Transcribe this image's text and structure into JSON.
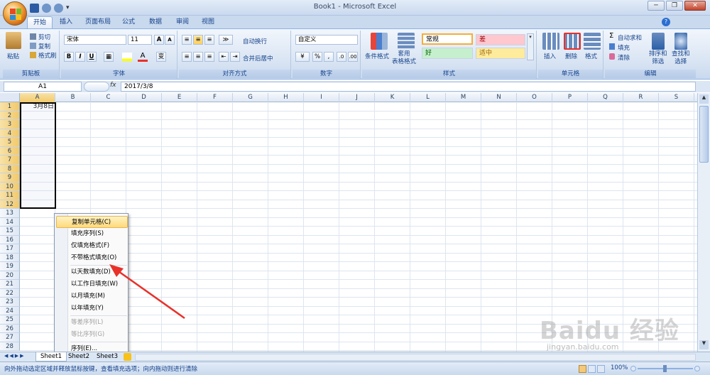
{
  "window": {
    "title": "Book1 - Microsoft Excel",
    "minimize": "─",
    "restore": "❐",
    "close": "✕"
  },
  "tabs": [
    "开始",
    "插入",
    "页面布局",
    "公式",
    "数据",
    "审阅",
    "视图"
  ],
  "ribbon": {
    "clipboard": {
      "label": "剪贴板",
      "paste": "粘贴",
      "cut": "剪切",
      "copy": "复制",
      "format_painter": "格式刷"
    },
    "font": {
      "label": "字体",
      "font_name": "宋体",
      "font_size": "11",
      "bold": "B",
      "italic": "I",
      "underline": "U",
      "grow": "A",
      "shrink": "A",
      "phonetic": "变"
    },
    "alignment": {
      "label": "对齐方式",
      "wrap": "自动换行",
      "merge": "合并后居中"
    },
    "number": {
      "label": "数字",
      "format": "自定义",
      "percent": "%",
      "comma": ","
    },
    "styles": {
      "label": "样式",
      "cond_format": "条件格式",
      "table_format": "套用\n表格格式",
      "normal": "常规",
      "bad": "差",
      "good": "好",
      "neutral": "适中"
    },
    "cells": {
      "label": "单元格",
      "insert": "插入",
      "delete": "删除",
      "format": "格式"
    },
    "editing": {
      "label": "编辑",
      "autosum": "自动求和",
      "fill": "填充",
      "clear": "清除",
      "sort": "排序和\n筛选",
      "find": "查找和\n选择"
    }
  },
  "formula_bar": {
    "name_box": "A1",
    "fx": "fx",
    "value": "2017/3/8"
  },
  "columns": [
    "A",
    "B",
    "C",
    "D",
    "E",
    "F",
    "G",
    "H",
    "I",
    "J",
    "K",
    "L",
    "M",
    "N",
    "O",
    "P",
    "Q",
    "R",
    "S"
  ],
  "rows": [
    "1",
    "2",
    "3",
    "4",
    "5",
    "6",
    "7",
    "8",
    "9",
    "10",
    "11",
    "12",
    "13",
    "14",
    "15",
    "16",
    "17",
    "18",
    "19",
    "20",
    "21",
    "22",
    "23",
    "24",
    "25",
    "26",
    "27",
    "28"
  ],
  "cells": {
    "A1": "3月8日"
  },
  "context_menu": {
    "items": [
      {
        "label": "复制单元格(C)",
        "state": "highlighted"
      },
      {
        "label": "填充序列(S)",
        "state": "normal"
      },
      {
        "label": "仅填充格式(F)",
        "state": "normal"
      },
      {
        "label": "不带格式填充(O)",
        "state": "normal"
      },
      {
        "label": "以天数填充(D)",
        "state": "normal"
      },
      {
        "label": "以工作日填充(W)",
        "state": "normal"
      },
      {
        "label": "以月填充(M)",
        "state": "normal"
      },
      {
        "label": "以年填充(Y)",
        "state": "normal"
      },
      {
        "label": "等差序列(L)",
        "state": "disabled"
      },
      {
        "label": "等比序列(G)",
        "state": "disabled"
      },
      {
        "label": "序列(E)...",
        "state": "normal"
      }
    ]
  },
  "sheets": [
    "Sheet1",
    "Sheet2",
    "Sheet3"
  ],
  "status": {
    "text": "向外拖动选定区域并释放鼠标按键，查看填充选项；向内拖动则进行清除",
    "zoom": "100%"
  },
  "watermark": {
    "brand": "Baidu 经验",
    "url": "jingyan.baidu.com"
  },
  "colors": {
    "accent": "#15428b",
    "ribbon_bg": "#dbe6f4",
    "arrow": "#e8312b",
    "highlight": "#ffd97a"
  }
}
